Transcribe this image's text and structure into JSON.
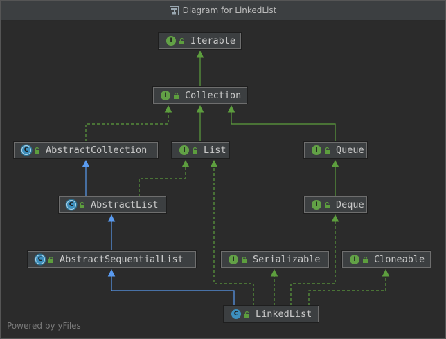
{
  "window": {
    "title": "Diagram for LinkedList"
  },
  "footer": {
    "text": "Powered by yFiles"
  },
  "colors": {
    "extends_class": "#5a9bf0",
    "implements": "#5d9e3e",
    "interface_badge": "#62a146",
    "class_badge": "#3d8fbd"
  },
  "nodes": {
    "iterable": {
      "label": "Iterable",
      "kind": "interface"
    },
    "collection": {
      "label": "Collection",
      "kind": "interface"
    },
    "abstract_collection": {
      "label": "AbstractCollection",
      "kind": "abstract-class"
    },
    "list": {
      "label": "List",
      "kind": "interface"
    },
    "queue": {
      "label": "Queue",
      "kind": "interface"
    },
    "abstract_list": {
      "label": "AbstractList",
      "kind": "abstract-class"
    },
    "deque": {
      "label": "Deque",
      "kind": "interface"
    },
    "abstract_sequential_list": {
      "label": "AbstractSequentialList",
      "kind": "abstract-class"
    },
    "serializable": {
      "label": "Serializable",
      "kind": "interface"
    },
    "cloneable": {
      "label": "Cloneable",
      "kind": "interface"
    },
    "linked_list": {
      "label": "LinkedList",
      "kind": "class"
    }
  },
  "edges": [
    {
      "from": "collection",
      "to": "iterable",
      "type": "extends-interface"
    },
    {
      "from": "abstract_collection",
      "to": "collection",
      "type": "implements"
    },
    {
      "from": "list",
      "to": "collection",
      "type": "extends-interface"
    },
    {
      "from": "queue",
      "to": "collection",
      "type": "extends-interface"
    },
    {
      "from": "abstract_list",
      "to": "abstract_collection",
      "type": "extends-class"
    },
    {
      "from": "abstract_list",
      "to": "list",
      "type": "implements"
    },
    {
      "from": "deque",
      "to": "queue",
      "type": "extends-interface"
    },
    {
      "from": "abstract_sequential_list",
      "to": "abstract_list",
      "type": "extends-class"
    },
    {
      "from": "linked_list",
      "to": "abstract_sequential_list",
      "type": "extends-class"
    },
    {
      "from": "linked_list",
      "to": "list",
      "type": "implements"
    },
    {
      "from": "linked_list",
      "to": "serializable",
      "type": "implements"
    },
    {
      "from": "linked_list",
      "to": "deque",
      "type": "implements"
    },
    {
      "from": "linked_list",
      "to": "cloneable",
      "type": "implements"
    }
  ]
}
